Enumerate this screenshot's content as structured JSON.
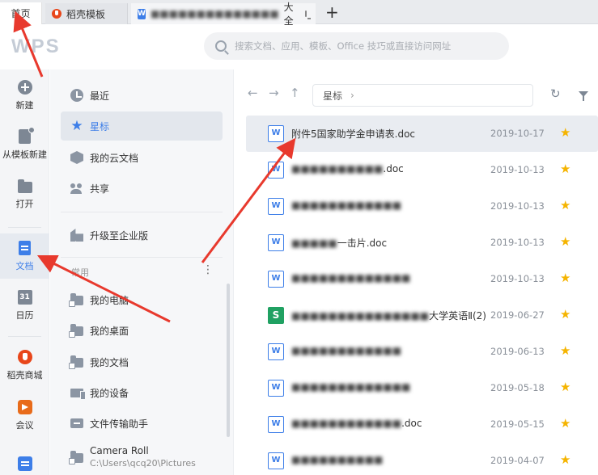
{
  "tabs": {
    "home": "首页",
    "daoke": "稻壳模板",
    "doc_blurred": "■■■■■■■■■■■■■■",
    "doc_suffix": "大全",
    "add": "+"
  },
  "header": {
    "logo": "WPS",
    "search_placeholder": "搜索文档、应用、模板、Office 技巧或直接访问网址"
  },
  "rail": {
    "new": "新建",
    "from_template": "从模板新建",
    "open": "打开",
    "docs": "文档",
    "calendar": "日历",
    "calendar_glyph": "31",
    "mall": "稻壳商城",
    "meeting": "会议"
  },
  "nav": {
    "recent": "最近",
    "starred": "星标",
    "cloud": "我的云文档",
    "shared": "共享",
    "enterprise": "升级至企业版",
    "section_common": "常用",
    "more": "⋮",
    "my_computer": "我的电脑",
    "my_desktop": "我的桌面",
    "my_documents": "我的文档",
    "my_devices": "我的设备",
    "file_transfer": "文件传输助手",
    "camera_roll": "Camera Roll",
    "camera_path": "C:\\Users\\qcq20\\Pictures"
  },
  "main": {
    "breadcrumb": "星标",
    "breadcrumb_chevron": "›",
    "back": "←",
    "forward": "→",
    "up": "↑",
    "refresh": "↻"
  },
  "files": [
    {
      "type": "W",
      "name_visible": "附件5国家助学金申请表.doc",
      "name_blurred": "",
      "date": "2019-10-17"
    },
    {
      "type": "W",
      "name_visible": ".doc",
      "name_blurred": "■■■■■■■■■■",
      "date": "2019-10-13"
    },
    {
      "type": "W",
      "name_visible": "",
      "name_blurred": "■■■■■■■■■■■■",
      "date": "2019-10-13"
    },
    {
      "type": "W",
      "name_visible": "一击片.doc",
      "name_blurred": "■■■■■",
      "date": "2019-10-13"
    },
    {
      "type": "W",
      "name_visible": "",
      "name_blurred": "■■■■■■■■■■■■■",
      "date": "2019-10-13"
    },
    {
      "type": "S",
      "name_visible": "大学英语Ⅱ(2)",
      "name_blurred": "■■■■■■■■■■■■■■■",
      "date": "2019-06-27"
    },
    {
      "type": "W",
      "name_visible": "",
      "name_blurred": "■■■■■■■■■■■■",
      "date": "2019-06-13"
    },
    {
      "type": "W",
      "name_visible": "",
      "name_blurred": "■■■■■■■■■■■■■",
      "date": "2019-05-18"
    },
    {
      "type": "W",
      "name_visible": ".doc",
      "name_blurred": "■■■■■■■■■■■■",
      "date": "2019-05-15"
    },
    {
      "type": "W",
      "name_visible": "",
      "name_blurred": "■■■■■■■■■■",
      "date": "2019-04-07"
    }
  ],
  "colors": {
    "accent": "#3d7ee8",
    "star": "#f5b400",
    "annotation_arrow": "#e8392d"
  }
}
